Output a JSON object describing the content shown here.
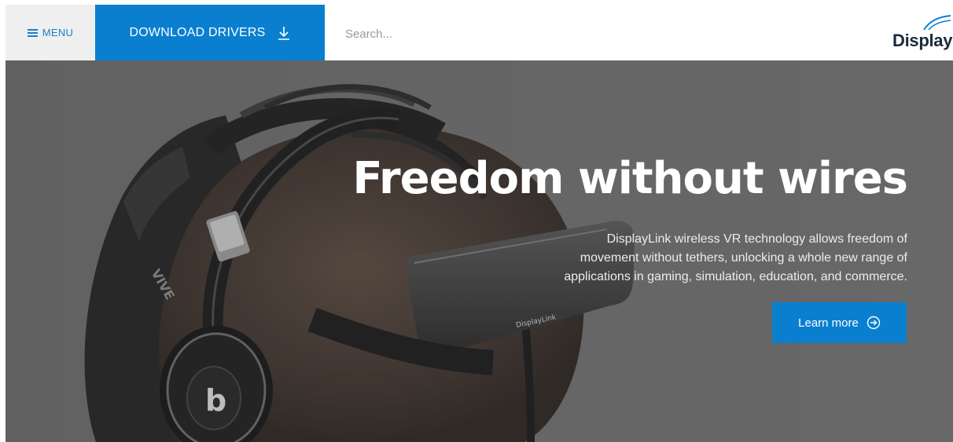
{
  "nav": {
    "menu_label": "MENU",
    "download_label": "DOWNLOAD DRIVERS",
    "search_placeholder": "Search...",
    "logo_text": "Display"
  },
  "hero": {
    "title": "Freedom without wires",
    "description": "DisplayLink wireless VR technology allows freedom of movement without tethers, unlocking a whole new range of applications in gaming, simulation, education, and commerce.",
    "cta_label": "Learn more",
    "headset_brand": "VIVE",
    "headphone_brand": "b",
    "device_label": "DisplayLink"
  },
  "colors": {
    "accent": "#0a7fd0",
    "menu_bg": "#efefef",
    "hero_bg": "#6f6f6f"
  },
  "icons": {
    "menu": "hamburger-icon",
    "download": "download-arrow-icon",
    "cta": "circle-arrow-right-icon",
    "logo": "signal-arc-icon"
  }
}
